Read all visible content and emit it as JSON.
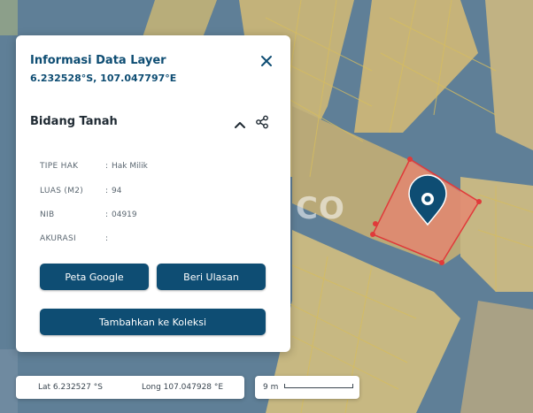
{
  "panel": {
    "title": "Informasi Data Layer",
    "coordinates": "6.232528°S, 107.047797°E",
    "section_title": "Bidang Tanah",
    "attributes": [
      {
        "key": "TIPE HAK",
        "sep": ":",
        "value": "Hak Milik"
      },
      {
        "key": "LUAS (M2)",
        "sep": ":",
        "value": "94"
      },
      {
        "key": "NIB",
        "sep": ":",
        "value": "04919"
      },
      {
        "key": "AKURASI",
        "sep": ":",
        "value": ""
      }
    ],
    "buttons": {
      "google_map": "Peta Google",
      "review": "Beri Ulasan",
      "add_collection": "Tambahkan ke Koleksi"
    }
  },
  "status_bar": {
    "lat": "Lat 6.232527 °S",
    "long": "Long 107.047928 °E"
  },
  "scale": {
    "label": "9 m"
  },
  "map": {
    "watermark": "CO"
  },
  "icons": [
    "close-icon",
    "chevron-up-icon",
    "share-icon",
    "location-pin-icon"
  ],
  "colors": {
    "primary": "#0e4d73",
    "parcel_fill": "#e8836f",
    "parcel_stroke": "#e03a3a",
    "parcel_grid": "#d6bd5f"
  }
}
